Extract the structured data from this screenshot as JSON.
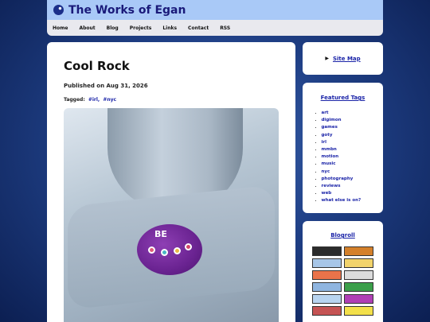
{
  "site": {
    "title": "The Works of Egan"
  },
  "nav": [
    "Home",
    "About",
    "Blog",
    "Projects",
    "Links",
    "Contact",
    "RSS"
  ],
  "post": {
    "title": "Cool Rock",
    "date": "Published on Aug 31, 2026",
    "tags_label": "Tagged:",
    "tags": [
      "#irl,",
      "#nyc"
    ],
    "photo_text": "BE"
  },
  "sidebar": {
    "site_map": "Site Map",
    "featured_heading": "Featured Tags",
    "featured_tags": [
      "art",
      "digimon",
      "games",
      "goty",
      "irl",
      "mmbn",
      "motion",
      "music",
      "nyc",
      "photography",
      "reviews",
      "web",
      "what else is on?"
    ],
    "blogroll_heading": "Blogroll",
    "badge_colors": [
      "#2b2b2b",
      "#d4802a",
      "#a7c6e8",
      "#f2d36b",
      "#e9734a",
      "#dcdcdc",
      "#8fb5e0",
      "#3b9f4a",
      "#b8d4f0",
      "#b03fb5",
      "#c55353",
      "#f3e04a"
    ]
  }
}
